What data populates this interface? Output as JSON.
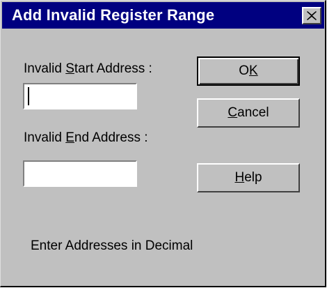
{
  "dialog": {
    "title": "Add Invalid Register Range",
    "close_glyph": "✕"
  },
  "start_address": {
    "label": "Invalid Start Address :",
    "mnemonic": "S",
    "value": ""
  },
  "end_address": {
    "label": "Invalid End Address :",
    "mnemonic": "E",
    "value": ""
  },
  "buttons": {
    "ok": "OK",
    "ok_mnemonic": "K",
    "cancel": "Cancel",
    "cancel_mnemonic": "C",
    "help": "Help",
    "help_mnemonic": "H"
  },
  "hint": "Enter Addresses in Decimal",
  "colors": {
    "face": "#c0c0c0",
    "titlebar": "#000080",
    "title_text": "#ffffff"
  }
}
